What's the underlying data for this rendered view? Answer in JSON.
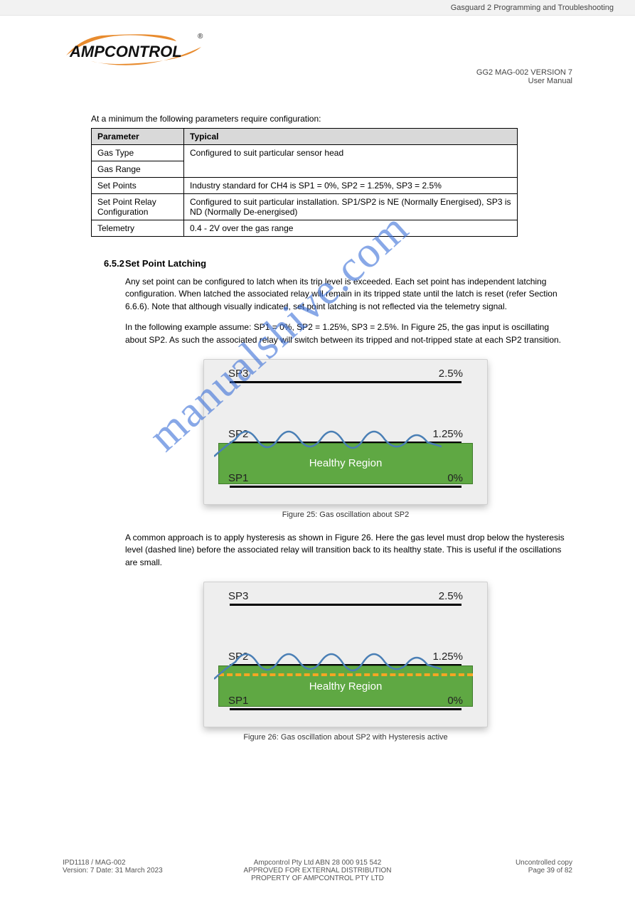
{
  "header_doc_title": "Gasguard 2 Programming and Troubleshooting",
  "logo_registered": "®",
  "brand_name": "AMPCONTROL",
  "page_label_line1": "GG2 MAG-002 VERSION 7",
  "page_label_line2": "User Manual",
  "intro_line": "At a minimum the following parameters require configuration:",
  "table": {
    "headers": [
      "Parameter",
      "Typical"
    ],
    "rows": [
      [
        "Gas Type",
        "Configured to suit particular sensor head"
      ],
      [
        "Gas Range",
        ""
      ],
      [
        "Set Points",
        "Industry standard for CH4 is SP1 = 0%, SP2 = 1.25%, SP3 = 2.5%"
      ],
      [
        "Set Point Relay Configuration",
        "Configured to suit particular installation. SP1/SP2 is NE (Normally Energised), SP3 is ND (Normally De-energised)"
      ],
      [
        "Telemetry",
        "0.4 - 2V over the gas range"
      ]
    ]
  },
  "section_number": "6.5.2",
  "section_title": "Set Point Latching",
  "section_p1": "Any set point can be configured to latch when its trip level is exceeded. Each set point has independent latching configuration. When latched the associated relay will remain in its tripped state until the latch is reset (refer Section 6.6.6). Note that although visually indicated, set point latching is not reflected via the telemetry signal.",
  "section_p2": "In the following example assume: SP1 = 0%, SP2 = 1.25%, SP3 = 2.5%. In Figure 25, the gas input is oscillating about SP2. As such the associated relay will switch between its tripped and not-tripped state at each SP2 transition.",
  "fig1_caption": "Figure 25: Gas oscillation about SP2",
  "section_p3": "A common approach is to apply hysteresis as shown in Figure 26. Here the gas level must drop below the hysteresis level (dashed line) before the associated relay will transition back to its healthy state. This is useful if the oscillations are small.",
  "fig2_caption": "Figure 26: Gas oscillation about SP2 with Hysteresis active",
  "chart_data": [
    {
      "type": "line",
      "title": "Gas oscillation about SP2",
      "ylabel": "",
      "xlabel": "",
      "ylim": [
        0,
        2.5
      ],
      "annotations": [
        "Healthy Region"
      ],
      "setpoints": [
        {
          "name": "SP3",
          "value": 2.5,
          "label": "2.5%"
        },
        {
          "name": "SP2",
          "value": 1.25,
          "label": "1.25%"
        },
        {
          "name": "SP1",
          "value": 0,
          "label": "0%"
        }
      ],
      "series": [
        {
          "name": "gas",
          "x": [
            0,
            1,
            2,
            3,
            4,
            5,
            6,
            7,
            8,
            9,
            10,
            11,
            12,
            13
          ],
          "values": [
            0.6,
            1.0,
            1.45,
            1.05,
            1.45,
            1.0,
            1.4,
            1.05,
            1.5,
            1.05,
            1.45,
            1.0,
            1.3,
            1.1
          ]
        }
      ]
    },
    {
      "type": "line",
      "title": "Gas oscillation about SP2 with Hysteresis active",
      "ylabel": "",
      "xlabel": "",
      "ylim": [
        0,
        2.5
      ],
      "annotations": [
        "Healthy Region"
      ],
      "setpoints": [
        {
          "name": "SP3",
          "value": 2.5,
          "label": "2.5%"
        },
        {
          "name": "SP2",
          "value": 1.25,
          "label": "1.25%"
        },
        {
          "name": "SP1",
          "value": 0,
          "label": "0%"
        }
      ],
      "hysteresis": 1.1,
      "series": [
        {
          "name": "gas",
          "x": [
            0,
            1,
            2,
            3,
            4,
            5,
            6,
            7,
            8,
            9,
            10,
            11,
            12,
            13
          ],
          "values": [
            0.6,
            1.0,
            1.45,
            1.05,
            1.45,
            1.0,
            1.4,
            1.05,
            1.5,
            1.05,
            1.45,
            1.0,
            1.3,
            1.1
          ]
        }
      ]
    }
  ],
  "healthy_region_label": "Healthy Region",
  "sp3_left": "SP3",
  "sp3_right": "2.5%",
  "sp2_left": "SP2",
  "sp2_right": "1.25%",
  "sp1_left": "SP1",
  "sp1_right": "0%",
  "watermark": "manualshive.com",
  "footer_left_line1": "IPD1118 / MAG-002",
  "footer_left_line2": "Version: 7  Date: 31 March 2023",
  "footer_center_line1": "Ampcontrol Pty Ltd  ABN 28 000 915 542",
  "footer_center_line2": "APPROVED FOR EXTERNAL DISTRIBUTION  PROPERTY OF AMPCONTROL PTY LTD",
  "footer_right_line1": "Uncontrolled copy",
  "footer_right_line2": "Page 39 of 82"
}
